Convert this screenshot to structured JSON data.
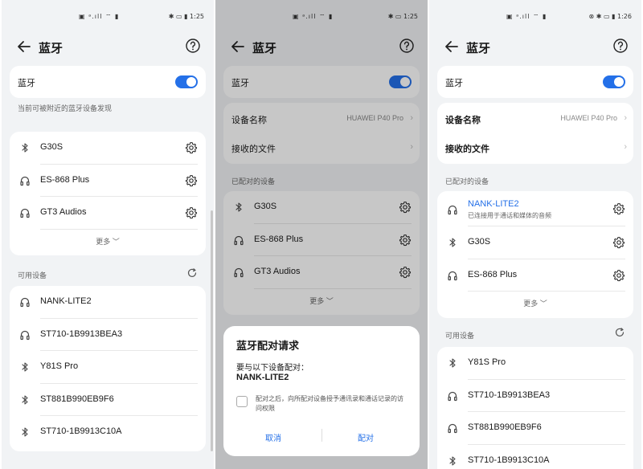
{
  "status": {
    "icons_left": "▣ ᵃ.ıll ⌔ ▮",
    "icons_right_1": "✱ ▭ ▮ 1:25",
    "icons_right_2": "✱ ▭ 1:25",
    "icons_right_3": "⊗ ✱ ▭ ▮ 1:26"
  },
  "title": "蓝牙",
  "bluetooth_label": "蓝牙",
  "discoverable_text": "当前可被附近的蓝牙设备发现",
  "device_name_label": "设备名称",
  "device_name_value": "HUAWEI P40 Pro",
  "received_files_label": "接收的文件",
  "paired_header": "已配对的设备",
  "available_header": "可用设备",
  "more_label": "更多 ﹀",
  "screen1": {
    "paired": [
      {
        "name": "G30S",
        "icon": "bluetooth-icon"
      },
      {
        "name": "ES-868 Plus",
        "icon": "headphones-icon"
      },
      {
        "name": "GT3 Audios",
        "icon": "headphones-icon"
      }
    ],
    "available": [
      {
        "name": "NANK-LITE2",
        "icon": "headphones-icon"
      },
      {
        "name": "ST710-1B9913BEA3",
        "icon": "headphones-icon"
      },
      {
        "name": "Y81S Pro",
        "icon": "bluetooth-icon"
      },
      {
        "name": "ST881B990EB9F6",
        "icon": "bluetooth-icon"
      },
      {
        "name": "ST710-1B9913C10A",
        "icon": "bluetooth-icon"
      }
    ]
  },
  "screen2": {
    "paired": [
      {
        "name": "G30S",
        "icon": "bluetooth-icon"
      },
      {
        "name": "ES-868 Plus",
        "icon": "headphones-icon"
      },
      {
        "name": "GT3 Audios",
        "icon": "headphones-icon"
      }
    ],
    "dialog": {
      "title": "蓝牙配对请求",
      "message": "要与以下设备配对：",
      "device": "NANK-LITE2",
      "checkbox_text": "配对之后，向所配对设备授予通讯录和通话记录的访问权限",
      "cancel": "取消",
      "confirm": "配对"
    }
  },
  "screen3": {
    "connected": {
      "name": "NANK-LITE2",
      "subtitle": "已连接用于通话和媒体的音频",
      "color": "#2470e8"
    },
    "paired": [
      {
        "name": "G30S",
        "icon": "bluetooth-icon"
      },
      {
        "name": "ES-868 Plus",
        "icon": "headphones-icon"
      }
    ],
    "available": [
      {
        "name": "Y81S Pro",
        "icon": "bluetooth-icon"
      },
      {
        "name": "ST710-1B9913BEA3",
        "icon": "headphones-icon"
      },
      {
        "name": "ST881B990EB9F6",
        "icon": "headphones-icon"
      },
      {
        "name": "ST710-1B9913C10A",
        "icon": "bluetooth-icon"
      }
    ]
  },
  "colors": {
    "accent": "#2470e8",
    "background": "#f1f3f5",
    "card": "#ffffff"
  }
}
